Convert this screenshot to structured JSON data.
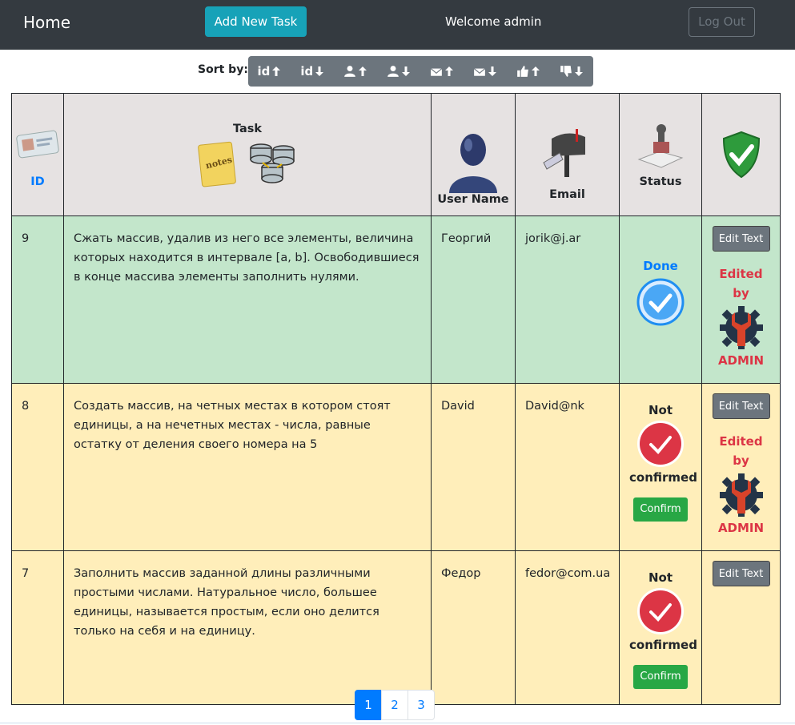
{
  "navbar": {
    "home": "Home",
    "add_task": "Add New Task",
    "welcome": "Welcome admin",
    "logout": "Log Out"
  },
  "sort": {
    "label": "Sort by:",
    "buttons": [
      {
        "text": "id",
        "dir": "up",
        "icon": "text-id"
      },
      {
        "text": "id",
        "dir": "down",
        "icon": "text-id"
      },
      {
        "text": "",
        "dir": "up",
        "icon": "user-icon"
      },
      {
        "text": "",
        "dir": "down",
        "icon": "user-icon"
      },
      {
        "text": "",
        "dir": "up",
        "icon": "envelope-icon"
      },
      {
        "text": "",
        "dir": "down",
        "icon": "envelope-icon"
      },
      {
        "text": "",
        "dir": "up",
        "icon": "thumbs-up-icon"
      },
      {
        "text": "",
        "dir": "down",
        "icon": "thumbs-down-icon"
      }
    ]
  },
  "table": {
    "headers": {
      "id": "ID",
      "task": "Task",
      "user": "User Name",
      "email": "Email",
      "status": "Status"
    },
    "rows": [
      {
        "id": "9",
        "task": "Сжать массив, удалив из него все элементы, величина которых находится в интервале [a, b]. Освободившиеся в конце массива элементы заполнить нулями.",
        "user": "Георгий",
        "email": "jorik@j.ar",
        "status": "Done",
        "edit": "Edit Text",
        "edited_by": "Edited by",
        "editor": "ADMIN"
      },
      {
        "id": "8",
        "task": "Создать массив, на четных местах в котором стоят единицы, а на нечетных местах - числа, равные остатку от деления своего номера на 5",
        "user": "David",
        "email": "David@nk",
        "status_line1": "Not",
        "status_line2": "confirmed",
        "confirm": "Confirm",
        "edit": "Edit Text",
        "edited_by": "Edited by",
        "editor": "ADMIN"
      },
      {
        "id": "7",
        "task": "Заполнить массив заданной длины различными простыми числами. Натуральное число, большее единицы, называется простым, если оно делится только на себя и на единицу.",
        "user": "Федор",
        "email": "fedor@com.ua",
        "status_line1": "Not",
        "status_line2": "confirmed",
        "confirm": "Confirm",
        "edit": "Edit Text"
      }
    ]
  },
  "pagination": [
    "1",
    "2",
    "3"
  ]
}
